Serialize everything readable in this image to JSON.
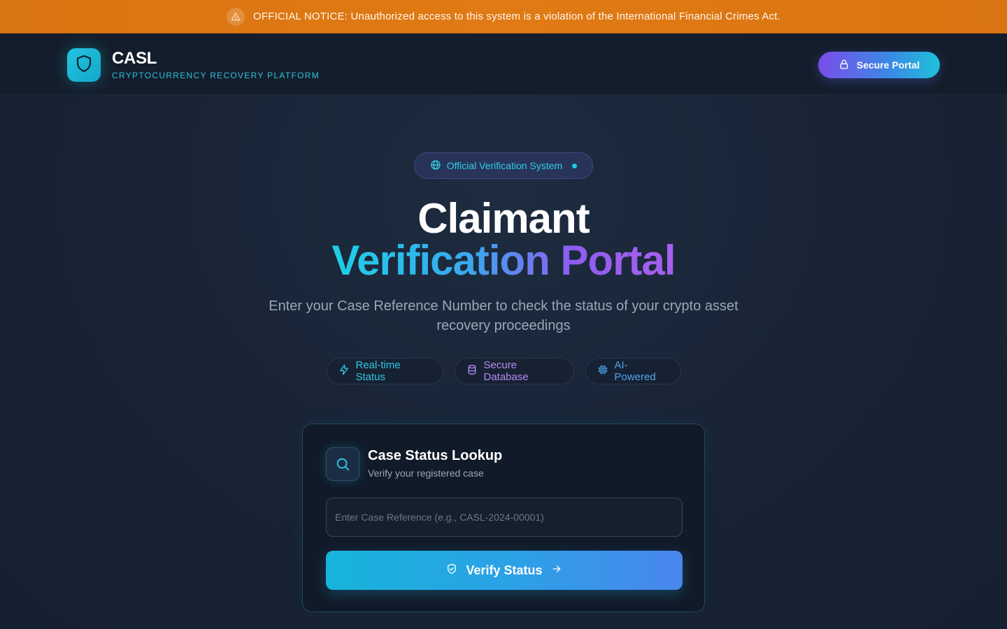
{
  "notice": {
    "icon": "warning-triangle-icon",
    "text": "OFFICIAL NOTICE: Unauthorized access to this system is a violation of the International Financial Crimes Act."
  },
  "header": {
    "logo_icon": "shield-icon",
    "brand_name": "CASL",
    "brand_subtitle": "CRYPTOCURRENCY RECOVERY PLATFORM",
    "portal_button": {
      "icon": "lock-icon",
      "label": "Secure Portal"
    }
  },
  "hero": {
    "badge": {
      "icon": "globe-icon",
      "label": "Official Verification System"
    },
    "title_line1": "Claimant",
    "title_line2": "Verification Portal",
    "subtitle": "Enter your Case Reference Number to check the status of your crypto asset recovery proceedings",
    "features": [
      {
        "icon": "lightning-icon",
        "label": "Real-time Status"
      },
      {
        "icon": "database-icon",
        "label": "Secure Database"
      },
      {
        "icon": "cpu-chip-icon",
        "label": "AI-Powered"
      }
    ]
  },
  "lookup_card": {
    "icon": "search-icon",
    "title": "Case Status Lookup",
    "subtitle": "Verify your registered case",
    "input": {
      "value": "",
      "placeholder": "Enter Case Reference (e.g., CASL-2024-00001)"
    },
    "submit": {
      "label": "Verify Status",
      "icon": "shield-check-icon",
      "trailing_icon": "arrow-right-icon"
    }
  },
  "colors": {
    "notice_bg": "#e07a14",
    "accent_cyan": "#22c4e0",
    "accent_purple": "#8f5cf0",
    "page_bg": "#1a2638"
  }
}
